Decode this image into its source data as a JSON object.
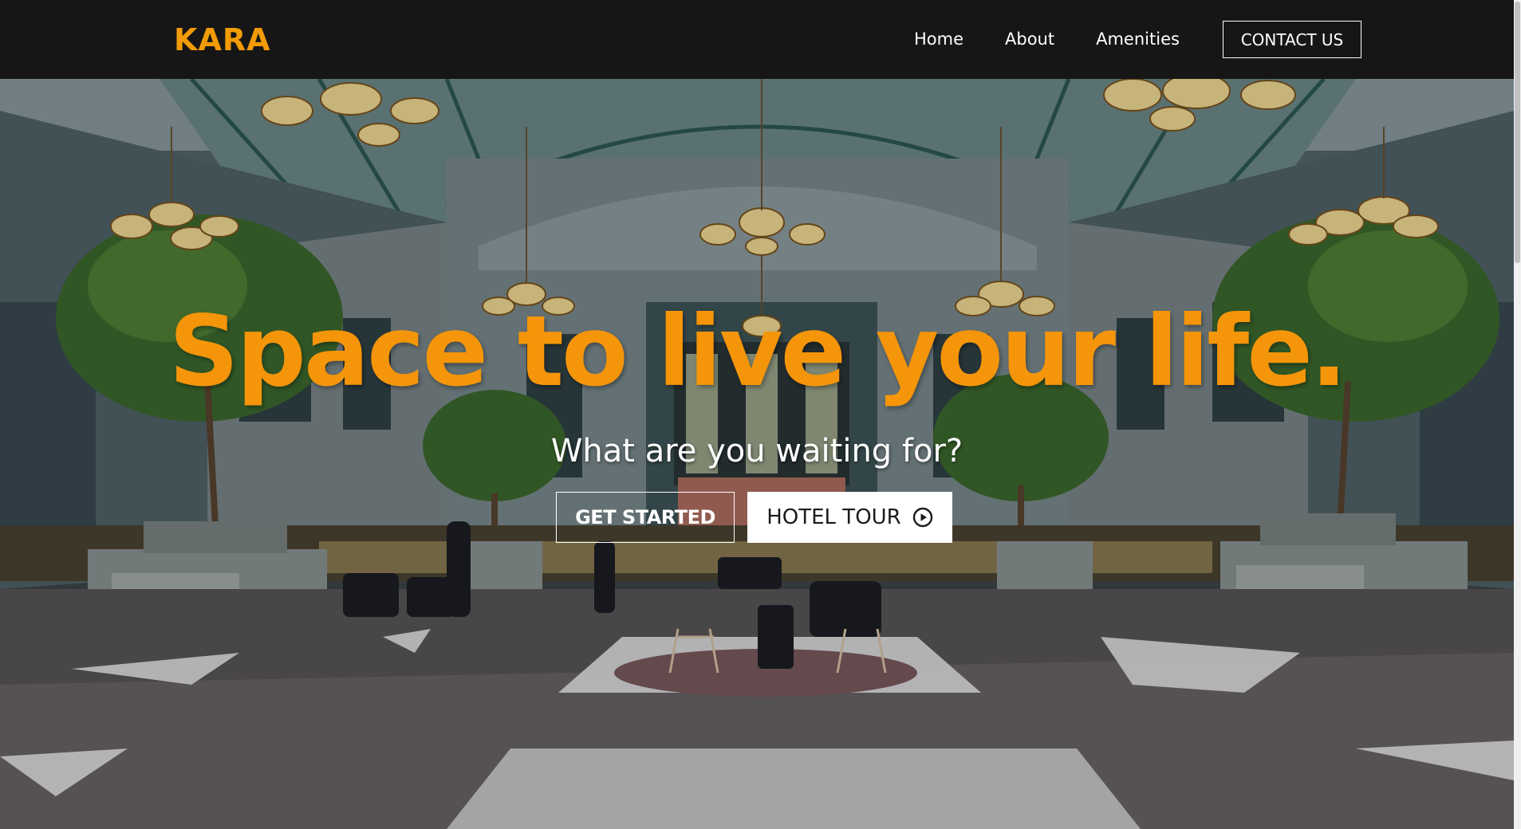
{
  "nav": {
    "brand": "KARA",
    "links": [
      "Home",
      "About",
      "Amenities"
    ],
    "contact_label": "CONTACT US"
  },
  "hero": {
    "headline": "Space to live your life.",
    "subheadline": "What are you waiting for?",
    "primary_cta": "GET STARTED",
    "secondary_cta": "HOTEL TOUR",
    "secondary_icon": "play-circle-icon"
  },
  "colors": {
    "accent": "#f5950a",
    "navbar": "#161616",
    "text_light": "#ffffff"
  }
}
